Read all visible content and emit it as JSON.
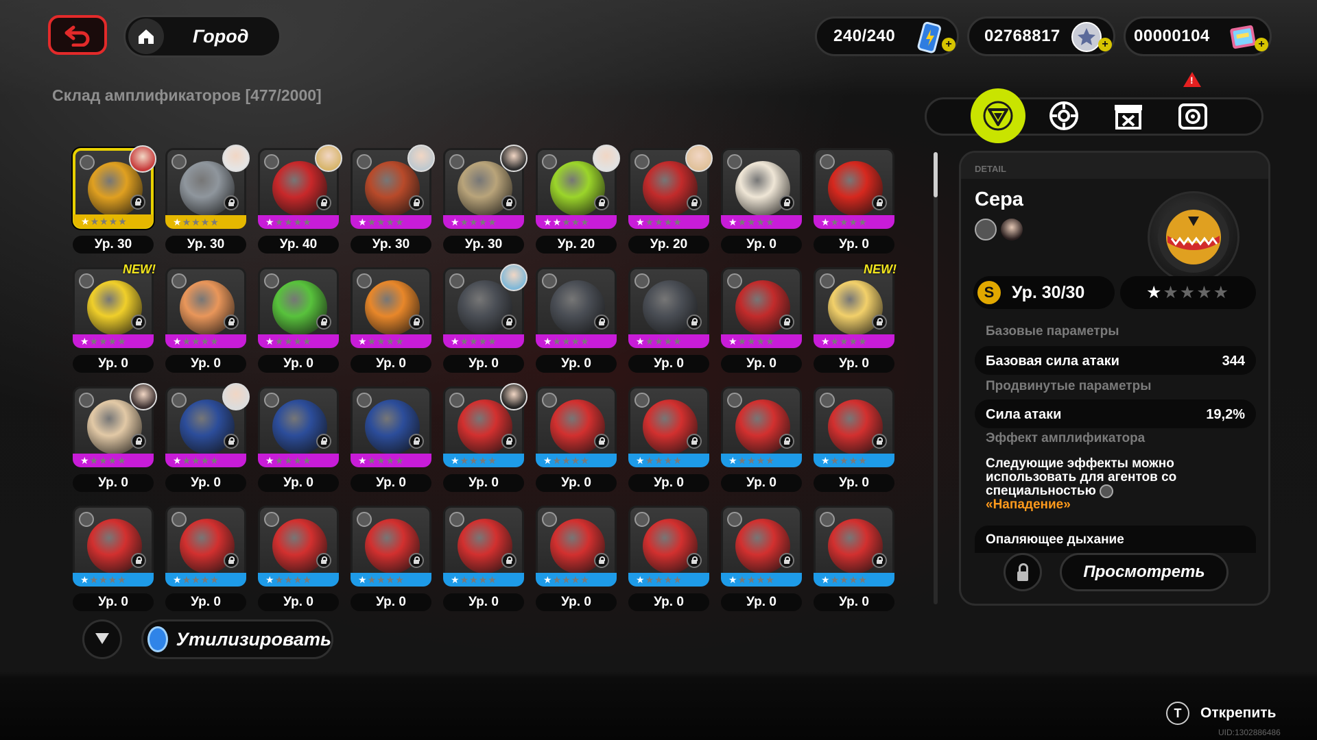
{
  "topbar": {
    "location": "Город",
    "battery": "240/240",
    "denny": "02768817",
    "film": "00000104"
  },
  "storage_title": "Склад амплификаторов [477/2000]",
  "tabs": [
    {
      "name": "tab-all-icon",
      "active": true
    },
    {
      "name": "tab-disc-icon",
      "active": false
    },
    {
      "name": "tab-cancel-icon",
      "active": false
    },
    {
      "name": "tab-camera-icon",
      "active": false,
      "alert": "!"
    }
  ],
  "colors": {
    "rarity_s": "#e6b800",
    "rarity_a": "#c81cd8",
    "rarity_b": "#1e9be8",
    "accent": "#c9e400"
  },
  "grid_rows": [
    [
      {
        "level": "Ур. 30",
        "rarity": "s",
        "stars": 1,
        "art": "#e0a020",
        "agent": "#c73a3a",
        "selected": true
      },
      {
        "level": "Ур. 30",
        "rarity": "s",
        "stars": 1,
        "art": "#8f969d",
        "agent": "#e5e5e5"
      },
      {
        "level": "Ур. 40",
        "rarity": "a",
        "stars": 1,
        "art": "#c8282a",
        "agent": "#d7b56b"
      },
      {
        "level": "Ур. 30",
        "rarity": "a",
        "stars": 1,
        "art": "#b84a2a",
        "agent": "#bfc9cf"
      },
      {
        "level": "Ур. 30",
        "rarity": "a",
        "stars": 1,
        "art": "#b9a47a",
        "agent": "#2d2d2d"
      },
      {
        "level": "Ур. 20",
        "rarity": "a",
        "stars": 2,
        "art": "#9bd52a",
        "agent": "#e2e2e2"
      },
      {
        "level": "Ур. 20",
        "rarity": "a",
        "stars": 1,
        "art": "#c22b2b",
        "agent": "#e0c19a"
      },
      {
        "level": "Ур. 0",
        "rarity": "a",
        "stars": 1,
        "art": "#efe6d6"
      },
      {
        "level": "Ур. 0",
        "rarity": "a",
        "stars": 1,
        "art": "#d6281e"
      }
    ],
    [
      {
        "level": "Ур. 0",
        "rarity": "a",
        "stars": 1,
        "art": "#f0cf2a",
        "new": "NEW!"
      },
      {
        "level": "Ур. 0",
        "rarity": "a",
        "stars": 1,
        "art": "#e9965a"
      },
      {
        "level": "Ур. 0",
        "rarity": "a",
        "stars": 1,
        "art": "#58c23c"
      },
      {
        "level": "Ур. 0",
        "rarity": "a",
        "stars": 1,
        "art": "#e8872a"
      },
      {
        "level": "Ур. 0",
        "rarity": "a",
        "stars": 1,
        "art": "#4a4e55",
        "agent": "#7fb8d8"
      },
      {
        "level": "Ур. 0",
        "rarity": "a",
        "stars": 1,
        "art": "#4a4e55"
      },
      {
        "level": "Ур. 0",
        "rarity": "a",
        "stars": 1,
        "art": "#4a4e55"
      },
      {
        "level": "Ур. 0",
        "rarity": "a",
        "stars": 1,
        "art": "#c22b2b"
      },
      {
        "level": "Ур. 0",
        "rarity": "a",
        "stars": 1,
        "art": "#f2d06a",
        "new": "NEW!"
      }
    ],
    [
      {
        "level": "Ур. 0",
        "rarity": "a",
        "stars": 1,
        "art": "#e2c9a6",
        "agent": "#3a2f2f"
      },
      {
        "level": "Ур. 0",
        "rarity": "a",
        "stars": 1,
        "art": "#2c4d9a",
        "agent": "#dcdcdc"
      },
      {
        "level": "Ур. 0",
        "rarity": "a",
        "stars": 1,
        "art": "#2c4d9a"
      },
      {
        "level": "Ур. 0",
        "rarity": "a",
        "stars": 1,
        "art": "#2c4d9a"
      },
      {
        "level": "Ур. 0",
        "rarity": "b",
        "stars": 1,
        "art": "#d2302f",
        "agent": "#222"
      },
      {
        "level": "Ур. 0",
        "rarity": "b",
        "stars": 1,
        "art": "#d2302f"
      },
      {
        "level": "Ур. 0",
        "rarity": "b",
        "stars": 1,
        "art": "#d2302f"
      },
      {
        "level": "Ур. 0",
        "rarity": "b",
        "stars": 1,
        "art": "#d2302f"
      },
      {
        "level": "Ур. 0",
        "rarity": "b",
        "stars": 1,
        "art": "#d2302f"
      }
    ],
    [
      {
        "level": "Ур. 0",
        "rarity": "b",
        "stars": 1,
        "art": "#d2302f"
      },
      {
        "level": "Ур. 0",
        "rarity": "b",
        "stars": 1,
        "art": "#d2302f"
      },
      {
        "level": "Ур. 0",
        "rarity": "b",
        "stars": 1,
        "art": "#d2302f"
      },
      {
        "level": "Ур. 0",
        "rarity": "b",
        "stars": 1,
        "art": "#d2302f"
      },
      {
        "level": "Ур. 0",
        "rarity": "b",
        "stars": 1,
        "art": "#d2302f"
      },
      {
        "level": "Ур. 0",
        "rarity": "b",
        "stars": 1,
        "art": "#d2302f"
      },
      {
        "level": "Ур. 0",
        "rarity": "b",
        "stars": 1,
        "art": "#d2302f"
      },
      {
        "level": "Ур. 0",
        "rarity": "b",
        "stars": 1,
        "art": "#d2302f"
      },
      {
        "level": "Ур. 0",
        "rarity": "b",
        "stars": 1,
        "art": "#d2302f"
      }
    ]
  ],
  "detail": {
    "tag": "DETAIL",
    "name": "Сера",
    "level": "Ур. 30/30",
    "level_badge": "S",
    "stars_filled": 1,
    "stars_total": 5,
    "base_params_label": "Базовые параметры",
    "base_stat_name": "Базовая сила атаки",
    "base_stat_value": "344",
    "adv_params_label": "Продвинутые параметры",
    "adv_stat_name": "Сила атаки",
    "adv_stat_value": "19,2%",
    "effect_label": "Эффект амплификатора",
    "effect_text": "Следующие эффекты можно использовать для агентов со специальностью",
    "effect_specialty": "«Нападение»",
    "effect_name": "Опаляющее дыхание",
    "view_button": "Просмотреть"
  },
  "bottom": {
    "recycle_label": "Утилизировать",
    "unpin_key": "T",
    "unpin_label": "Открепить",
    "uid": "UID:1302886486"
  }
}
